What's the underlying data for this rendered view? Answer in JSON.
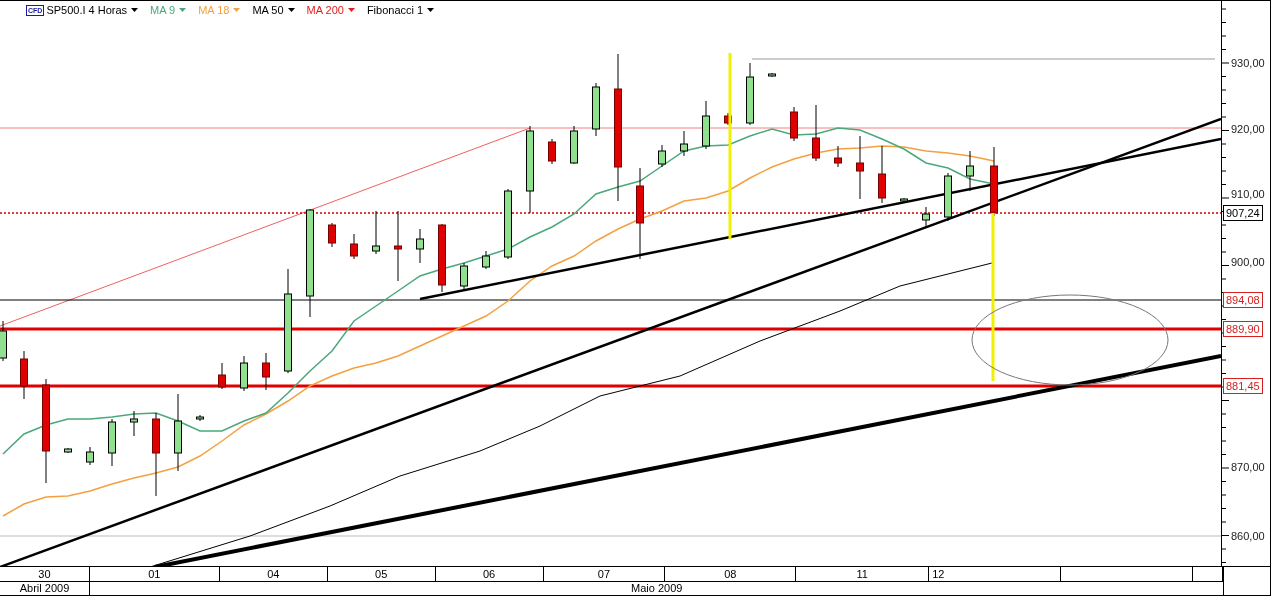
{
  "legend": {
    "badge": "CFD",
    "symbol": "SP500.I 4 Horas",
    "indicators": [
      {
        "label": "MA 9",
        "color": "#4aa87a"
      },
      {
        "label": "MA 18",
        "color": "#f5a040"
      },
      {
        "label": "MA 50",
        "color": "#000000"
      },
      {
        "label": "MA 200",
        "color": "#e02020"
      },
      {
        "label": "Fibonacci 1",
        "color": "#000000"
      }
    ]
  },
  "price_axis": {
    "ticks": [
      "930,00",
      "920,00",
      "910,00",
      "900,00",
      "870,00",
      "860,00"
    ],
    "tags": [
      {
        "text": "907,24",
        "kind": "last"
      },
      {
        "text": "894,08",
        "kind": "level"
      },
      {
        "text": "889,90",
        "kind": "level"
      },
      {
        "text": "881,45",
        "kind": "level"
      }
    ]
  },
  "time_axis": {
    "days": [
      "30",
      "01",
      "04",
      "05",
      "06",
      "07",
      "08",
      "11",
      "12"
    ],
    "months": [
      "Abril 2009",
      "Maio 2009"
    ]
  }
}
